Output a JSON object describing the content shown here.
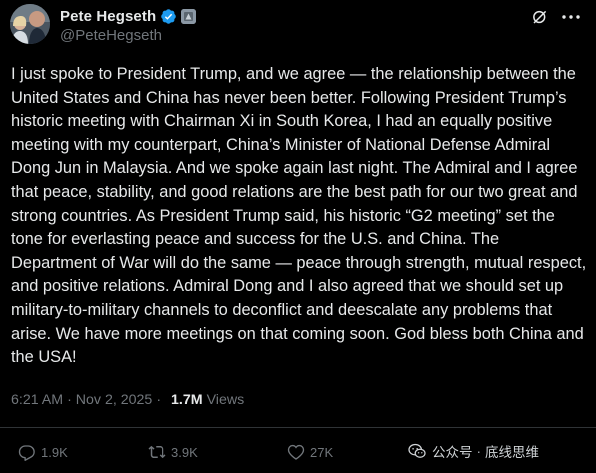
{
  "author": {
    "display_name": "Pete Hegseth",
    "handle": "@PeteHegseth",
    "verified_color": "#1d9bf0"
  },
  "header_icons": {
    "grok": "grok-icon",
    "more": "more-options-icon"
  },
  "tweet": {
    "text": "I just spoke to President Trump, and we agree — the relationship between the United States and China has never been better. Following President Trump’s historic meeting with Chairman Xi in South Korea, I had an equally positive meeting with my counterpart, China’s Minister of National Defense Admiral Dong Jun in Malaysia. And we spoke again last night. The Admiral and I agree that peace, stability, and good relations are the best path for our two great and strong countries. As President Trump said, his historic “G2 meeting” set the tone for everlasting peace and success for the U.S. and China. The Department of War will do the same — peace through strength, mutual respect, and positive relations. Admiral Dong and I also agreed that we should set up military-to-military channels to deconflict and deescalate any problems that arise. We have more meetings on that coming soon. God bless both China and the USA!"
  },
  "meta": {
    "time": "6:21 AM",
    "separator": "·",
    "date": "Nov 2, 2025",
    "views_count": "1.7M",
    "views_label": "Views"
  },
  "actions": {
    "replies": "1.9K",
    "reposts": "3.9K",
    "likes": "27K"
  },
  "watermark": {
    "source": "公众号",
    "separator": "·",
    "name": "底线思维"
  }
}
